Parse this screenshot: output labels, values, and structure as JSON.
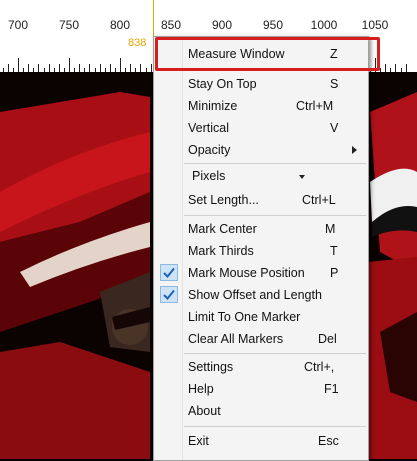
{
  "ruler": {
    "labels": [
      "700",
      "750",
      "800",
      "850",
      "900",
      "950",
      "1000",
      "1050"
    ],
    "cursor_value": "838"
  },
  "menu": {
    "measure_window": {
      "label": "Measure Window",
      "shortcut": "Z"
    },
    "stay_on_top": {
      "label": "Stay On Top",
      "shortcut": "S"
    },
    "minimize": {
      "label": "Minimize",
      "shortcut": "Ctrl+M"
    },
    "vertical": {
      "label": "Vertical",
      "shortcut": "V"
    },
    "opacity": {
      "label": "Opacity",
      "submenu_icon": "chevron-right-icon"
    },
    "units": {
      "selected": "Pixels",
      "icon": "chevron-down-icon"
    },
    "set_length": {
      "label": "Set Length...",
      "shortcut": "Ctrl+L"
    },
    "mark_center": {
      "label": "Mark Center",
      "shortcut": "M"
    },
    "mark_thirds": {
      "label": "Mark Thirds",
      "shortcut": "T"
    },
    "mark_mouse_position": {
      "label": "Mark Mouse Position",
      "shortcut": "P",
      "checked": true
    },
    "show_offset_and_length": {
      "label": "Show Offset and Length",
      "checked": true
    },
    "limit_to_one_marker": {
      "label": "Limit To One Marker"
    },
    "clear_all_markers": {
      "label": "Clear All Markers",
      "shortcut": "Del"
    },
    "settings": {
      "label": "Settings",
      "shortcut": "Ctrl+,"
    },
    "help": {
      "label": "Help",
      "shortcut": "F1"
    },
    "about": {
      "label": "About"
    },
    "exit": {
      "label": "Exit",
      "shortcut": "Esc"
    }
  },
  "colors": {
    "highlight": "#d81d1d",
    "ruler_cursor": "#e8a400",
    "check_bg": "#cfe3f7"
  }
}
